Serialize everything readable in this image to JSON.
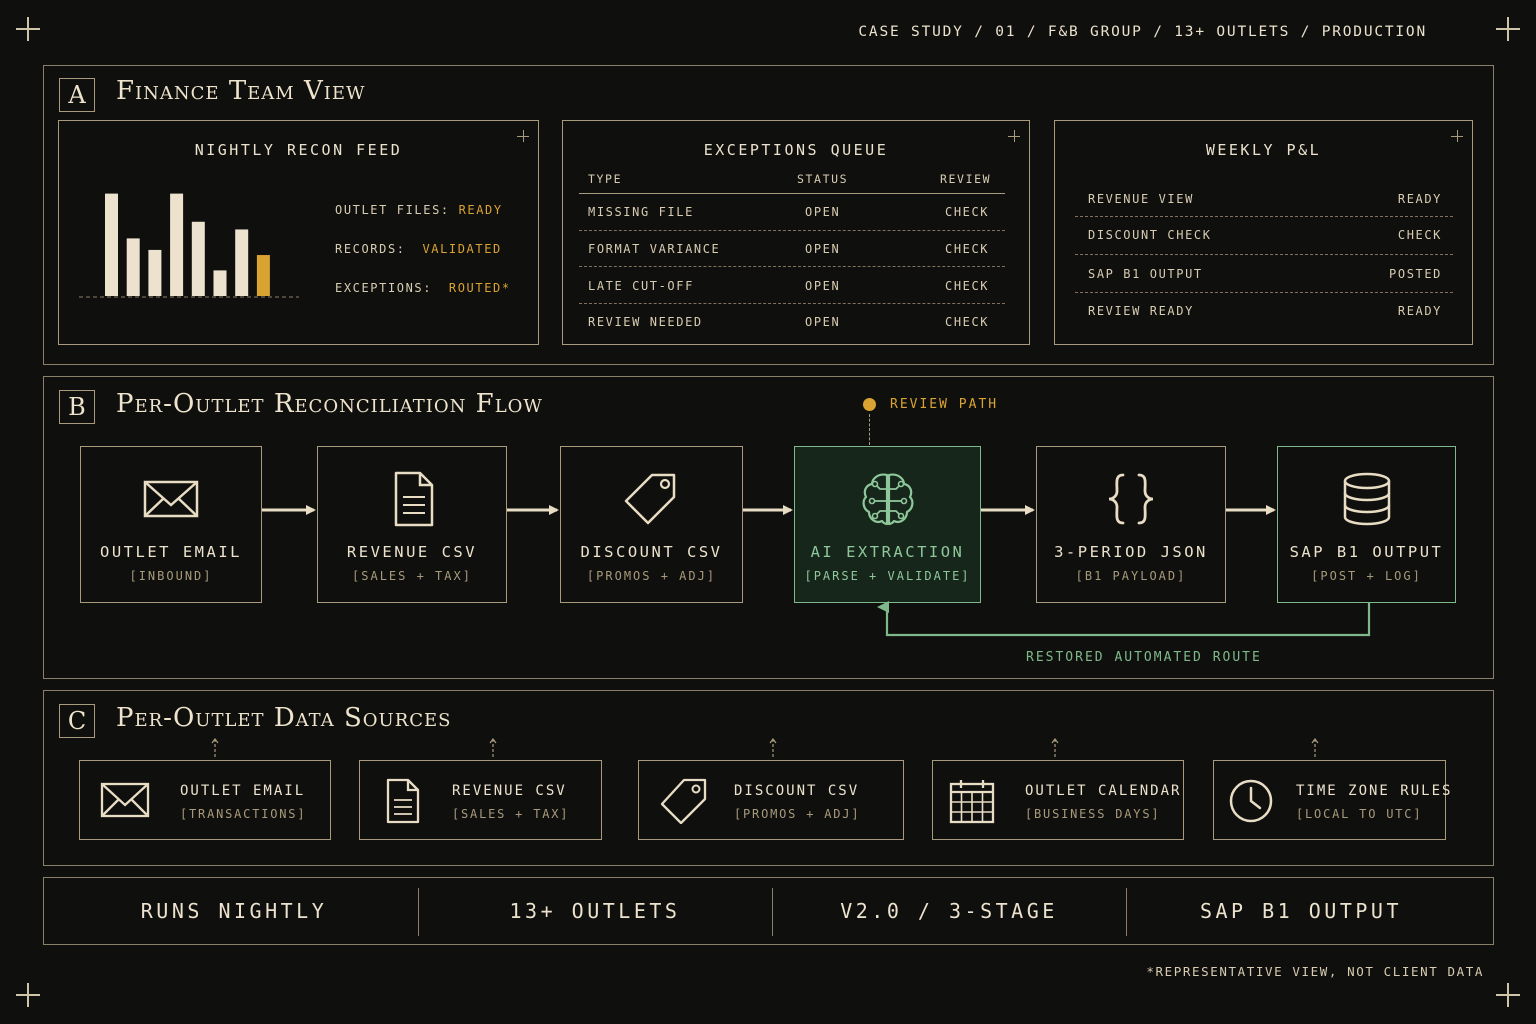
{
  "header": {
    "breadcrumb": "CASE STUDY / 01 / F&B GROUP / 13+ OUTLETS / PRODUCTION"
  },
  "section_a": {
    "letter": "A",
    "title": "Finance Team View",
    "recon_feed": {
      "title": "NIGHTLY RECON FEED",
      "bars": [
        0.8,
        0.45,
        0.36,
        0.8,
        0.58,
        0.2,
        0.52,
        0.32
      ],
      "highlight_index": 7,
      "rows": [
        {
          "label": "OUTLET FILES:",
          "value": "READY"
        },
        {
          "label": "RECORDS:",
          "value": "VALIDATED"
        },
        {
          "label": "EXCEPTIONS:",
          "value": "ROUTED*"
        }
      ]
    },
    "exceptions": {
      "title": "EXCEPTIONS QUEUE",
      "headers": [
        "TYPE",
        "STATUS",
        "REVIEW"
      ],
      "rows": [
        [
          "MISSING FILE",
          "OPEN",
          "CHECK"
        ],
        [
          "FORMAT VARIANCE",
          "OPEN",
          "CHECK"
        ],
        [
          "LATE CUT-OFF",
          "OPEN",
          "CHECK"
        ],
        [
          "REVIEW NEEDED",
          "OPEN",
          "CHECK"
        ]
      ]
    },
    "pnl": {
      "title": "WEEKLY P&L",
      "rows": [
        [
          "REVENUE VIEW",
          "READY"
        ],
        [
          "DISCOUNT CHECK",
          "CHECK"
        ],
        [
          "SAP B1 OUTPUT",
          "POSTED"
        ],
        [
          "REVIEW READY",
          "READY"
        ]
      ]
    }
  },
  "section_b": {
    "letter": "B",
    "title": "Per-Outlet Reconciliation Flow",
    "review_path": "REVIEW PATH",
    "steps": [
      {
        "label": "OUTLET EMAIL",
        "sub": "[INBOUND]",
        "icon": "envelope-icon"
      },
      {
        "label": "REVENUE CSV",
        "sub": "[SALES + TAX]",
        "icon": "document-icon"
      },
      {
        "label": "DISCOUNT CSV",
        "sub": "[PROMOS + ADJ]",
        "icon": "tag-icon"
      },
      {
        "label": "AI EXTRACTION",
        "sub": "[PARSE + VALIDATE]",
        "icon": "brain-icon"
      },
      {
        "label": "3-PERIOD JSON",
        "sub": "[B1 PAYLOAD]",
        "icon": "braces-icon"
      },
      {
        "label": "SAP B1 OUTPUT",
        "sub": "[POST + LOG]",
        "icon": "database-icon"
      }
    ],
    "loop_label": "RESTORED AUTOMATED ROUTE"
  },
  "section_c": {
    "letter": "C",
    "title": "Per-Outlet Data Sources",
    "sources": [
      {
        "label": "OUTLET EMAIL",
        "sub": "[TRANSACTIONS]",
        "icon": "envelope-icon"
      },
      {
        "label": "REVENUE CSV",
        "sub": "[SALES + TAX]",
        "icon": "document-icon"
      },
      {
        "label": "DISCOUNT CSV",
        "sub": "[PROMOS + ADJ]",
        "icon": "tag-icon"
      },
      {
        "label": "OUTLET CALENDAR",
        "sub": "[BUSINESS DAYS]",
        "icon": "calendar-icon"
      },
      {
        "label": "TIME ZONE RULES",
        "sub": "[LOCAL TO UTC]",
        "icon": "clock-icon"
      }
    ]
  },
  "stats": [
    "RUNS NIGHTLY",
    "13+ OUTLETS",
    "V2.0 / 3-STAGE",
    "SAP B1 OUTPUT"
  ],
  "footnote": "*REPRESENTATIVE VIEW, NOT CLIENT DATA",
  "colors": {
    "background": "#0f0f0d",
    "cream": "#e8dcc4",
    "gold": "#d9a332",
    "green": "#7fb98b",
    "border": "#a89a7c"
  }
}
